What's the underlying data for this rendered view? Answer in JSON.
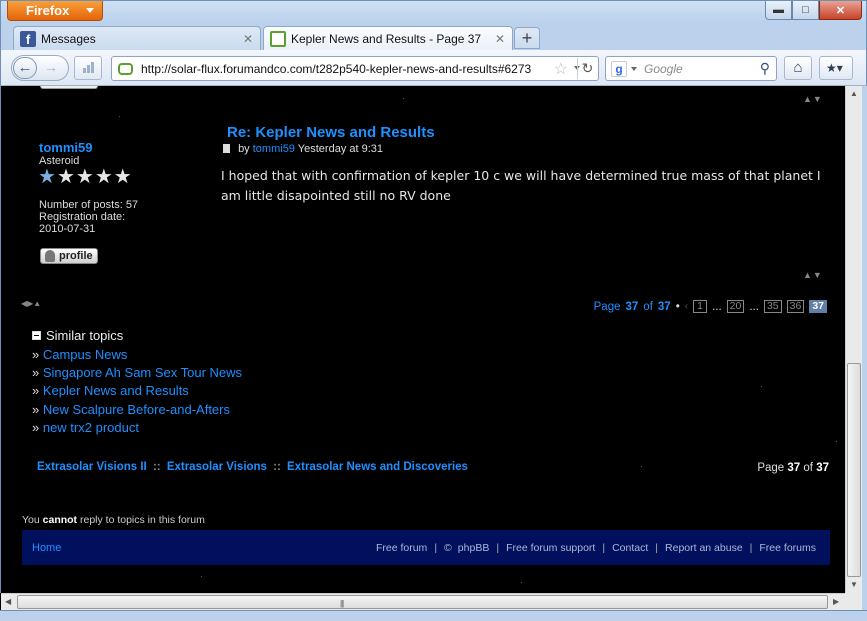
{
  "browser": {
    "menu_button": "Firefox",
    "window_buttons": {
      "minimize": "▬",
      "maximize": "□",
      "close": "✕"
    },
    "tabs": [
      {
        "label": "Messages",
        "favicon": "facebook-icon",
        "close": "✕"
      },
      {
        "label": "Kepler News and Results - Page 37",
        "favicon": "forum-bubble-icon",
        "close": "✕"
      }
    ],
    "new_tab": "+",
    "url": "http://solar-flux.forumandco.com/t282p540-kepler-news-and-results#6273",
    "search_placeholder": "Google"
  },
  "post": {
    "author": "tommi59",
    "rank": "Asteroid",
    "rank_stars": 1,
    "rank_stars_max": 5,
    "posts_label": "Number of posts: 57",
    "registration_label": "Registration date:",
    "registration_date": "2010-07-31",
    "profile_button": "profile",
    "title": "Re: Kepler News and Results",
    "meta_by": "by",
    "meta_author": "tommi59",
    "meta_time": "Yesterday at 9:31",
    "body": "I hoped that with confirmation of kepler 10 c we will have determined true mass of that planet I am little disapointed still no RV done"
  },
  "pagination": {
    "page_label": "Page",
    "current": "37",
    "of_label": "of",
    "total": "37",
    "pages": [
      "1",
      "...",
      "20",
      "...",
      "35",
      "36",
      "37"
    ]
  },
  "similar": {
    "heading": "Similar topics",
    "items": [
      "Campus News",
      "Singapore Ah Sam Sex Tour News",
      "Kepler News and Results",
      "New Scalpure Before-and-Afters",
      "new trx2 product"
    ]
  },
  "breadcrumb": {
    "items": [
      "Extrasolar Visions II",
      "Extrasolar Visions",
      "Extrasolar News and Discoveries"
    ],
    "separator": "::"
  },
  "page_of": {
    "page": "Page",
    "current": "37",
    "of": "of",
    "total": "37"
  },
  "notice": {
    "before": "You",
    "strong": "cannot",
    "after": "reply to topics in this forum"
  },
  "footer": {
    "home": "Home",
    "links": [
      "Free forum",
      "©",
      "phpBB",
      "Free forum support",
      "Contact",
      "Report an abuse",
      "Free forums"
    ]
  }
}
